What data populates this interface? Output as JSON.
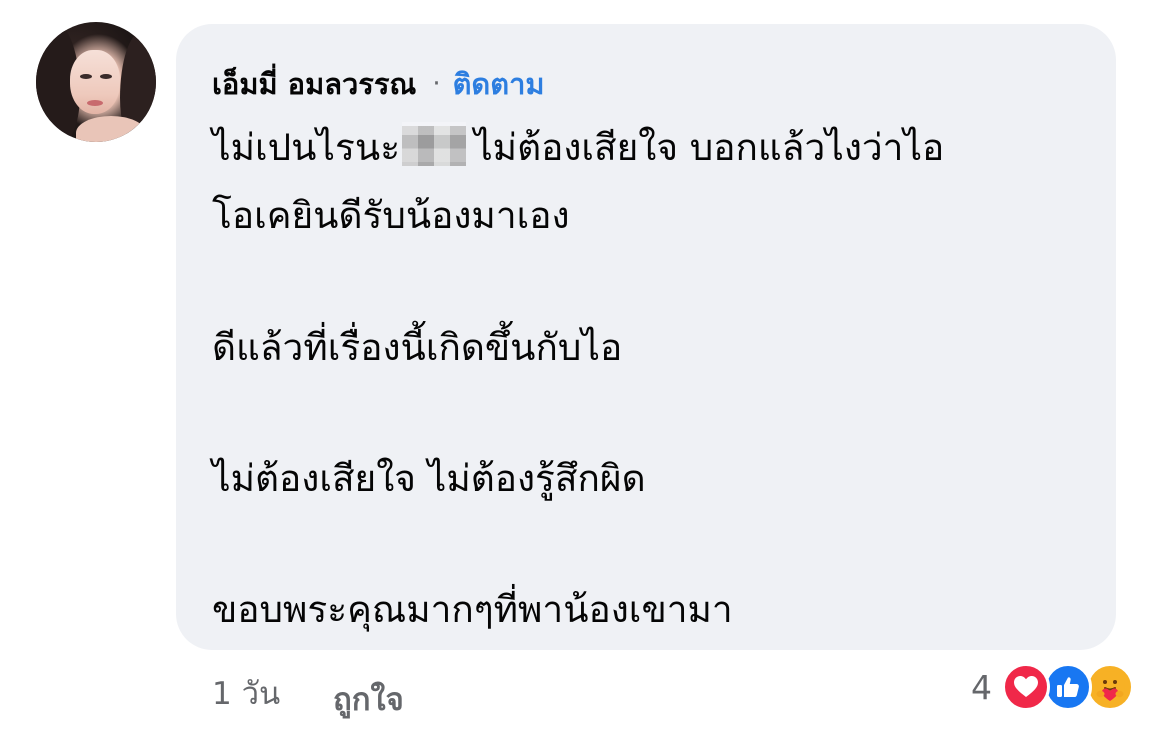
{
  "comment": {
    "author": "เอ็มมี่ อมลวรรณ",
    "separator": "·",
    "follow_label": "ติดตาม",
    "lines": [
      {
        "before_redaction": "ไม่เปนไรนะ",
        "after_redaction": "ไม่ต้องเสียใจ บอกแล้วไงว่าไอ"
      },
      "โอเคยินดีรับน้องมาเอง",
      "ดีแล้วที่เรื่องนี้เกิดขึ้นกับไอ",
      "ไม่ต้องเสียใจ ไม่ต้องรู้สึกผิด",
      "ขอบพระคุณมากๆที่พาน้องเขามา"
    ],
    "time": "1 วัน",
    "like_action": "ถูกใจ",
    "reaction_count": "4",
    "reactions": [
      "love-icon",
      "like-icon",
      "care-icon"
    ]
  },
  "colors": {
    "bubble": "#eff1f5",
    "link": "#2d7ee0",
    "meta": "#65676b",
    "love": "#f02849",
    "like": "#1877f2",
    "care": "#f7b125"
  }
}
